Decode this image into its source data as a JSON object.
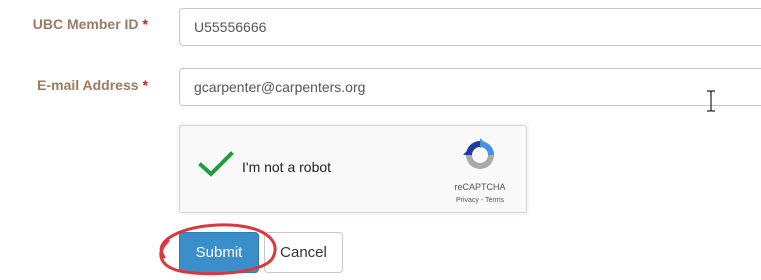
{
  "form": {
    "member_id": {
      "label": "UBC Member ID",
      "required_marker": "*",
      "value": "U55556666"
    },
    "email": {
      "label": "E-mail Address",
      "required_marker": "*",
      "value": "gcarpenter@carpenters.org"
    }
  },
  "recaptcha": {
    "checkbox_label": "I'm not a robot",
    "checked": true,
    "brand": "reCAPTCHA",
    "links": "Privacy - Terms",
    "check_color": "#1e9e3e"
  },
  "buttons": {
    "submit_label": "Submit",
    "cancel_label": "Cancel",
    "submit_color": "#3a8fcb"
  },
  "annotation": {
    "color": "#d9393e",
    "target": "Submit"
  },
  "icons": {
    "cursor": "text-cursor-icon",
    "check": "checkmark-icon",
    "recaptcha_logo": "recaptcha-logo-icon"
  }
}
